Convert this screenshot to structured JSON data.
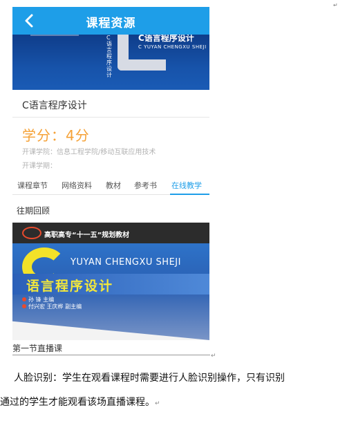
{
  "header": {
    "title": "课程资源",
    "back_icon": "chevron-left-icon"
  },
  "banner": {
    "cover_title": "C语言程序设计",
    "cover_subtitle": "C YUYAN CHENGXU SHEJI",
    "cover_vertical": "C语言程序设计"
  },
  "course": {
    "name": "C语言程序设计",
    "credit": "学分：4分",
    "college": "开课学院：信息工程学院/移动互联应用技术",
    "term": "开课学期："
  },
  "tabs": [
    {
      "label": "课程章节"
    },
    {
      "label": "网络资料"
    },
    {
      "label": "教材"
    },
    {
      "label": "参考书"
    },
    {
      "label": "在线教学",
      "active": true
    }
  ],
  "section": {
    "title": "往期回顾"
  },
  "book_cover": {
    "series": "高职高专“十一五”规划教材",
    "pinyin": "YUYAN CHENGXU SHEJI",
    "title": "语言程序设计",
    "author1": "孙  锋  主编",
    "author2": "付兴宏  王庆桦  副主编"
  },
  "live": {
    "title": "第一节直播课"
  },
  "document": {
    "para1": "人脸识别：学生在观看课程时需要进行人脸识别操作，只有识别",
    "para2": "通过的学生才能观看该场直播课程。",
    "return_mark": "↵"
  },
  "colors": {
    "accent": "#1e9ee8",
    "credit": "#f5a136"
  }
}
